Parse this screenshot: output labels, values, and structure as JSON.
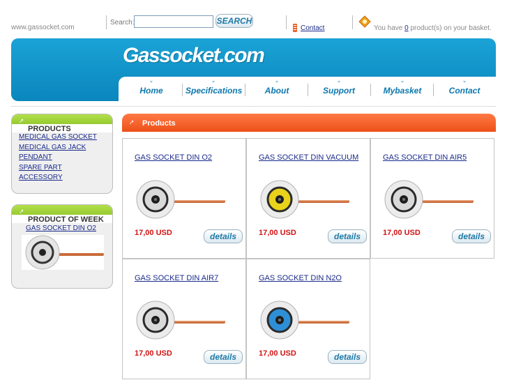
{
  "top": {
    "site_url": "www.gassocket.com",
    "search_label": "Search:",
    "search_value": "",
    "search_button": "SEARCH",
    "contact_label": "Contact",
    "basket_prefix": "You have ",
    "basket_count": "0",
    "basket_suffix": " product(s) on your basket."
  },
  "header": {
    "logo": "Gassocket.com",
    "nav": [
      "Home",
      "Specifications",
      "About",
      "Support",
      "Mybasket",
      "Contact"
    ]
  },
  "sidebar": {
    "products_title": "PRODUCTS",
    "products": [
      "MEDICAL GAS SOCKET",
      "MEDICAL GAS JACK",
      "PENDANT",
      "SPARE PART",
      "ACCESSORY"
    ],
    "week_title": "PRODUCT OF WEEK",
    "week_product": "GAS SOCKET DIN O2"
  },
  "main": {
    "title": "Products",
    "details_label": "details",
    "items": [
      {
        "name": "GAS SOCKET DIN O2",
        "price": "17,00 USD",
        "face_color": "#d9d9d9"
      },
      {
        "name": "GAS SOCKET DIN VACUUM",
        "price": "17,00 USD",
        "face_color": "#e8d21c"
      },
      {
        "name": "GAS SOCKET DIN AIR5",
        "price": "17,00 USD",
        "face_color": "#d9d9d9"
      },
      {
        "name": "GAS SOCKET DIN AIR7",
        "price": "17,00 USD",
        "face_color": "#d9d9d9"
      },
      {
        "name": "GAS SOCKET DIN N2O",
        "price": "17,00 USD",
        "face_color": "#2f8fd6"
      }
    ]
  },
  "colors": {
    "header_blue": "#1ba3d6",
    "sidebar_green": "#8cc63f",
    "products_orange": "#f05a1f",
    "price_red": "#d01313",
    "link_blue": "#1a2a8a"
  }
}
